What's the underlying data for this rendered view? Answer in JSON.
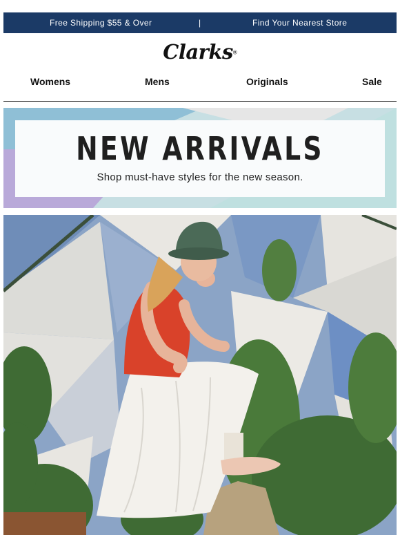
{
  "topbar": {
    "left_text": "Free Shipping $55 & Over",
    "separator": "|",
    "right_text": "Find Your Nearest Store"
  },
  "brand": {
    "name": "Clarks",
    "mark": "®"
  },
  "nav": {
    "items": [
      "Womens",
      "Mens",
      "Originals",
      "Sale"
    ]
  },
  "banner": {
    "title": "NEW ARRIVALS",
    "subtitle": "Shop must-have styles for the new season."
  },
  "colors": {
    "topbar_bg": "#1b3a66",
    "banner_lavender": "#b9a9d9",
    "banner_teal": "#bfe0e0",
    "banner_blue": "#8fbfd6"
  }
}
